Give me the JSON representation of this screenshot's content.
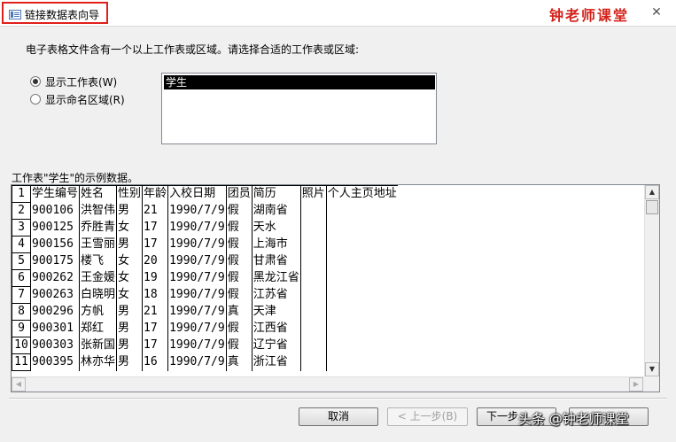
{
  "window": {
    "title": "链接数据表向导",
    "brand": "钟老师课堂",
    "close_glyph": "✕"
  },
  "intro_text": "电子表格文件含有一个以上工作表或区域。请选择合适的工作表或区域:",
  "options": {
    "worksheet_label": "显示工作表(W)",
    "named_range_label": "显示命名区域(R)",
    "selected": "worksheet"
  },
  "sheet_list": {
    "items": [
      "学生"
    ],
    "selected": "学生"
  },
  "sample_label": "工作表\"学生\"的示例数据。",
  "sample_rows": [
    [
      "1",
      "学生编号",
      "姓名",
      "性别",
      "年龄",
      "入校日期",
      "团员",
      "简历",
      "照片",
      "个人主页地址"
    ],
    [
      "2",
      "900106",
      "洪智伟",
      "男",
      "21",
      "1990/7/9",
      "假",
      "湖南省",
      "",
      ""
    ],
    [
      "3",
      "900125",
      "乔胜青",
      "女",
      "17",
      "1990/7/9",
      "假",
      "天水",
      "",
      ""
    ],
    [
      "4",
      "900156",
      "王雪丽",
      "男",
      "17",
      "1990/7/9",
      "假",
      "上海市",
      "",
      ""
    ],
    [
      "5",
      "900175",
      "楼飞",
      "女",
      "20",
      "1990/7/9",
      "假",
      "甘肃省",
      "",
      ""
    ],
    [
      "6",
      "900262",
      "王金媛",
      "女",
      "19",
      "1990/7/9",
      "假",
      "黑龙江省",
      "",
      ""
    ],
    [
      "7",
      "900263",
      "白晓明",
      "女",
      "18",
      "1990/7/9",
      "假",
      "江苏省",
      "",
      ""
    ],
    [
      "8",
      "900296",
      "方帆",
      "男",
      "21",
      "1990/7/9",
      "真",
      "天津",
      "",
      ""
    ],
    [
      "9",
      "900301",
      "郑红",
      "男",
      "17",
      "1990/7/9",
      "假",
      "江西省",
      "",
      ""
    ],
    [
      "10",
      "900303",
      "张新国",
      "男",
      "17",
      "1990/7/9",
      "假",
      "辽宁省",
      "",
      ""
    ],
    [
      "11",
      "900395",
      "林亦华",
      "男",
      "16",
      "1990/7/9",
      "真",
      "浙江省",
      "",
      ""
    ]
  ],
  "buttons": {
    "cancel": "取消",
    "back": "< 上一步(B)",
    "next": "下一步"
  },
  "watermark": "头条 @钟老师课堂"
}
